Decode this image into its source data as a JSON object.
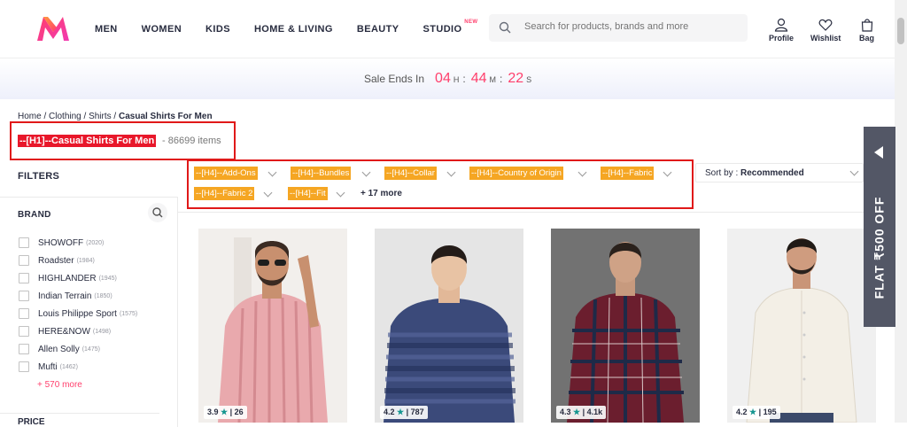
{
  "header": {
    "nav": [
      "MEN",
      "WOMEN",
      "KIDS",
      "HOME & LIVING",
      "BEAUTY",
      "STUDIO"
    ],
    "studio_badge": "NEW",
    "search_placeholder": "Search for products, brands and more",
    "icons": [
      {
        "name": "profile-icon",
        "label": "Profile"
      },
      {
        "name": "wishlist-icon",
        "label": "Wishlist"
      },
      {
        "name": "bag-icon",
        "label": "Bag"
      }
    ]
  },
  "sale": {
    "label": "Sale Ends In",
    "hours": "04",
    "hours_unit": "H",
    "minutes": "44",
    "minutes_unit": "M",
    "seconds": "22",
    "seconds_unit": "S"
  },
  "breadcrumb": {
    "items": [
      "Home",
      "Clothing",
      "Shirts"
    ],
    "current": "Casual Shirts For Men"
  },
  "title": {
    "tag": "--[H1]--Casual Shirts For Men",
    "count": "- 86699 items"
  },
  "filters": {
    "heading": "FILTERS",
    "brand_heading": "BRAND",
    "brands": [
      {
        "name": "SHOWOFF",
        "count": "(2020)"
      },
      {
        "name": "Roadster",
        "count": "(1984)"
      },
      {
        "name": "HIGHLANDER",
        "count": "(1945)"
      },
      {
        "name": "Indian Terrain",
        "count": "(1850)"
      },
      {
        "name": "Louis Philippe Sport",
        "count": "(1575)"
      },
      {
        "name": "HERE&NOW",
        "count": "(1498)"
      },
      {
        "name": "Allen Solly",
        "count": "(1475)"
      },
      {
        "name": "Mufti",
        "count": "(1462)"
      }
    ],
    "more": "+ 570 more",
    "price_heading": "PRICE"
  },
  "chips": [
    "--[H4]--Add-Ons",
    "--[H4]--Bundles",
    "--[H4]--Collar",
    "--[H4]--Country of Origin",
    "--[H4]--Fabric",
    "--[H4]--Fabric 2",
    "--[H4]--Fit"
  ],
  "more_filters": "+ 17 more",
  "sort": {
    "label": "Sort by : ",
    "value": "Recommended"
  },
  "products": [
    {
      "rating": "3.9",
      "reviews": "26",
      "shirt": "#e9a9ad",
      "bg": "#f2efec"
    },
    {
      "rating": "4.2",
      "reviews": "787",
      "shirt": "#3b4a7a",
      "bg": "#e5e5e5"
    },
    {
      "rating": "4.3",
      "reviews": "4.1k",
      "shirt": "#6b1e2e",
      "bg": "#727272"
    },
    {
      "rating": "4.2",
      "reviews": "195",
      "shirt": "#f3efe6",
      "bg": "#f0f0f0"
    }
  ],
  "side_tab": {
    "text": "FLAT ₹500 OFF"
  },
  "colors": {
    "accent": "#ff3f6c",
    "chip": "#f5a623",
    "h1": "#e8172a",
    "star": "#14958f"
  }
}
